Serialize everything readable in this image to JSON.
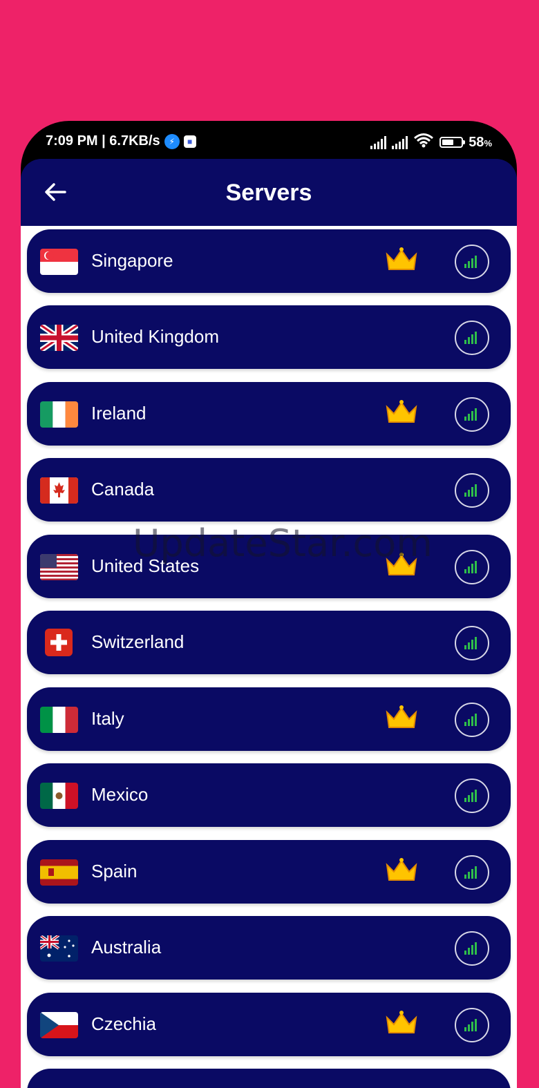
{
  "status_bar": {
    "time_speed": "7:09 PM | 6.7KB/s",
    "battery_pct": "58",
    "battery_unit": "%"
  },
  "header": {
    "title": "Servers"
  },
  "servers": [
    {
      "name": "Singapore",
      "flag": "sg",
      "premium": true
    },
    {
      "name": "United Kingdom",
      "flag": "gb",
      "premium": false
    },
    {
      "name": "Ireland",
      "flag": "ie",
      "premium": true
    },
    {
      "name": "Canada",
      "flag": "ca",
      "premium": false
    },
    {
      "name": "United States",
      "flag": "us",
      "premium": true
    },
    {
      "name": "Switzerland",
      "flag": "ch",
      "premium": false
    },
    {
      "name": "Italy",
      "flag": "it",
      "premium": true
    },
    {
      "name": "Mexico",
      "flag": "mx",
      "premium": false
    },
    {
      "name": "Spain",
      "flag": "es",
      "premium": true
    },
    {
      "name": "Australia",
      "flag": "au",
      "premium": false
    },
    {
      "name": "Czechia",
      "flag": "cz",
      "premium": true
    }
  ],
  "watermark": "UpdateStar.com",
  "icons": {
    "back": "arrow-left-icon",
    "premium": "crown-icon",
    "signal": "signal-strength-icon"
  },
  "colors": {
    "background": "#EE2268",
    "header": "#0A0A64",
    "row": "#0A0A64",
    "crown": "#FFC400",
    "signal": "#2FBF4A"
  }
}
